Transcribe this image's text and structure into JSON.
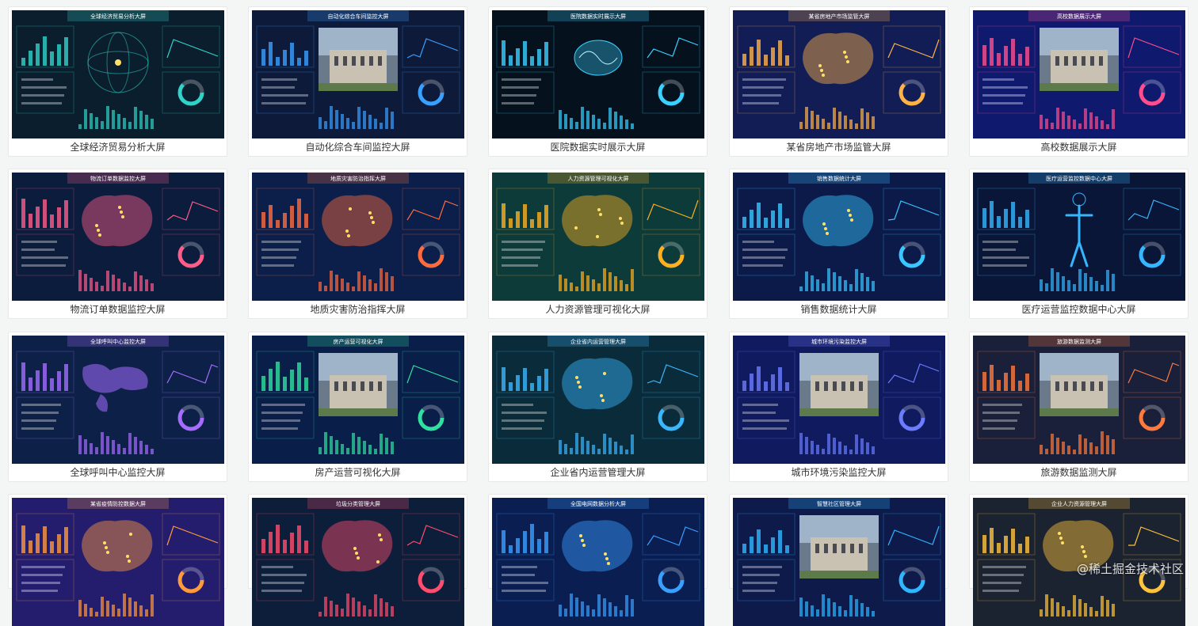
{
  "cards": [
    {
      "caption": "全球经济贸易分析大屏",
      "screen_title": "全球经济贸易分析大屏",
      "bg": "#0b1e2e",
      "accent": "#2fd3c8",
      "theme": "globe"
    },
    {
      "caption": "自动化综合车间监控大屏",
      "screen_title": "自动化综合车间监控大屏",
      "bg": "#0d1a3a",
      "accent": "#3aa0ff",
      "theme": "photo"
    },
    {
      "caption": "医院数据实时展示大屏",
      "screen_title": "医院数据实时展示大屏",
      "bg": "#05121e",
      "accent": "#3ad1ff",
      "theme": "brain"
    },
    {
      "caption": "某省房地产市场监管大屏",
      "screen_title": "某省房地产市场监管大屏",
      "bg": "#121d55",
      "accent": "#ffb347",
      "theme": "map"
    },
    {
      "caption": "高校数据展示大屏",
      "screen_title": "高校数据展示大屏",
      "bg": "#0f1a6e",
      "accent": "#ff4d8d",
      "theme": "photo"
    },
    {
      "caption": "物流订单数据监控大屏",
      "screen_title": "物流订单数据监控大屏",
      "bg": "#0b1c3c",
      "accent": "#ff5c8a",
      "theme": "map"
    },
    {
      "caption": "地质灾害防治指挥大屏",
      "screen_title": "地质灾害防治指挥大屏",
      "bg": "#0b1f4a",
      "accent": "#ff6b3d",
      "theme": "map"
    },
    {
      "caption": "人力资源管理可视化大屏",
      "screen_title": "人力资源管理可视化大屏",
      "bg": "#0d3b3a",
      "accent": "#ffb020",
      "theme": "map"
    },
    {
      "caption": "销售数据统计大屏",
      "screen_title": "销售数据统计大屏",
      "bg": "#0c1a4a",
      "accent": "#38c7ff",
      "theme": "map"
    },
    {
      "caption": "医疗运营监控数据中心大屏",
      "screen_title": "医疗运营监控数据中心大屏",
      "bg": "#0a1638",
      "accent": "#35b6ff",
      "theme": "body"
    },
    {
      "caption": "全球呼叫中心监控大屏",
      "screen_title": "全球呼叫中心监控大屏",
      "bg": "#0d2148",
      "accent": "#a66bff",
      "theme": "world"
    },
    {
      "caption": "房产运营可视化大屏",
      "screen_title": "房产运营可视化大屏",
      "bg": "#0a1e4a",
      "accent": "#31e0a0",
      "theme": "photo"
    },
    {
      "caption": "企业省内运营管理大屏",
      "screen_title": "企业省内运营管理大屏",
      "bg": "#0a2b3a",
      "accent": "#3ab8ff",
      "theme": "map"
    },
    {
      "caption": "城市环境污染监控大屏",
      "screen_title": "城市环境污染监控大屏",
      "bg": "#101a5e",
      "accent": "#6b7cff",
      "theme": "photo"
    },
    {
      "caption": "旅游数据监测大屏",
      "screen_title": "旅游数据监测大屏",
      "bg": "#1a1f3a",
      "accent": "#ff7a3d",
      "theme": "photo"
    },
    {
      "caption": "",
      "screen_title": "某省疫情防控数据大屏",
      "bg": "#241d6e",
      "accent": "#ff9a3d",
      "theme": "map"
    },
    {
      "caption": "",
      "screen_title": "垃圾分类管理大屏",
      "bg": "#0c1e3a",
      "accent": "#ff4d6d",
      "theme": "map"
    },
    {
      "caption": "",
      "screen_title": "全国电网数据分析大屏",
      "bg": "#0a1e52",
      "accent": "#3aa0ff",
      "theme": "map"
    },
    {
      "caption": "",
      "screen_title": "智慧社区管理大屏",
      "bg": "#0d1a4a",
      "accent": "#2fb6ff",
      "theme": "photo"
    },
    {
      "caption": "",
      "screen_title": "企业人力资源管理大屏",
      "bg": "#1b2230",
      "accent": "#ffc43d",
      "theme": "map"
    }
  ],
  "watermark": "@稀土掘金技术社区"
}
